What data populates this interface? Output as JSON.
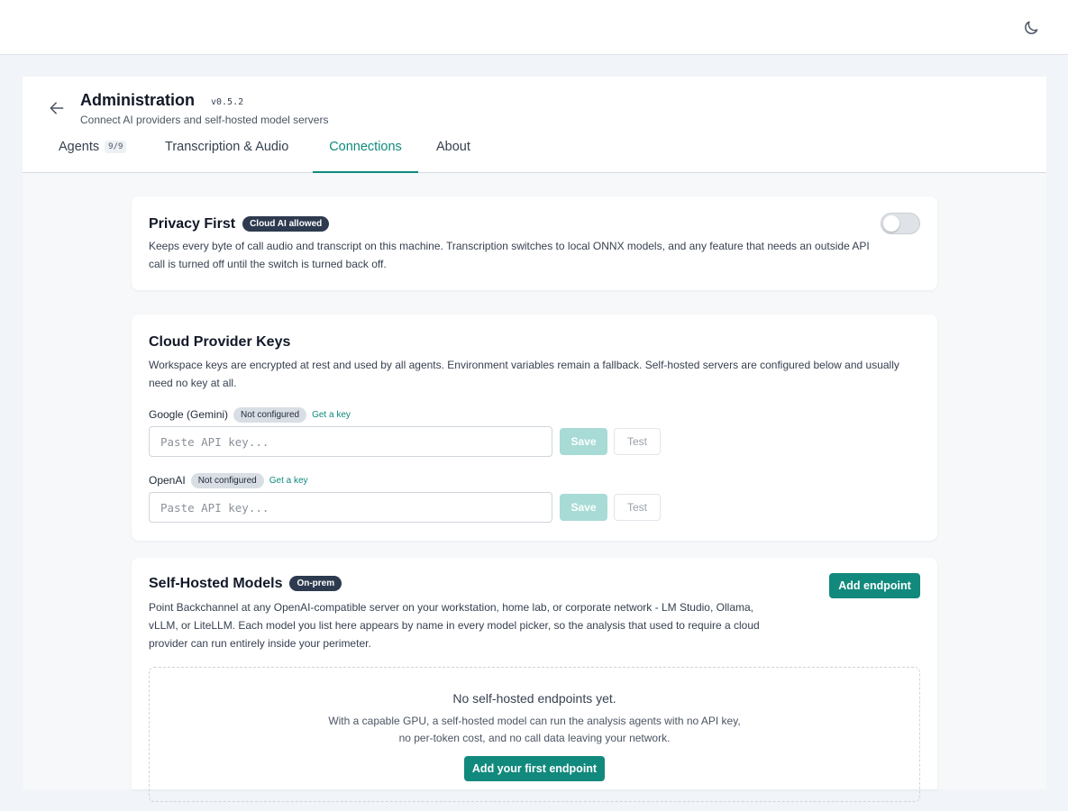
{
  "header": {
    "theme_icon": "moon-icon"
  },
  "page": {
    "title": "Administration",
    "version": "v0.5.2",
    "subtitle": "Connect AI providers and self-hosted model servers",
    "back_icon": "arrow-left-icon"
  },
  "tabs": [
    {
      "label": "Agents",
      "count": "9/9",
      "active": false
    },
    {
      "label": "Transcription & Audio",
      "active": false
    },
    {
      "label": "Connections",
      "active": true
    },
    {
      "label": "About",
      "active": false
    }
  ],
  "privacy": {
    "title": "Privacy First",
    "badge": "Cloud AI allowed",
    "description": "Keeps every byte of call audio and transcript on this machine. Transcription switches to local ONNX models, and any feature that needs an outside API call is turned off until the switch is turned back off.",
    "toggle_on": false
  },
  "cloud_keys": {
    "title": "Cloud Provider Keys",
    "description": "Workspace keys are encrypted at rest and used by all agents. Environment variables remain a fallback. Self-hosted servers are configured below and usually need no key at all.",
    "providers": [
      {
        "name": "Google (Gemini)",
        "status": "Not configured",
        "get_key": "Get a key",
        "placeholder": "Paste API key...",
        "save": "Save",
        "test": "Test"
      },
      {
        "name": "OpenAI",
        "status": "Not configured",
        "get_key": "Get a key",
        "placeholder": "Paste API key...",
        "save": "Save",
        "test": "Test"
      }
    ]
  },
  "self_hosted": {
    "title": "Self-Hosted Models",
    "badge": "On-prem",
    "add_button": "Add endpoint",
    "description": "Point Backchannel at any OpenAI-compatible server on your workstation, home lab, or corporate network - LM Studio, Ollama, vLLM, or LiteLLM. Each model you list here appears by name in every model picker, so the analysis that used to require a cloud provider can run entirely inside your perimeter.",
    "empty_title": "No self-hosted endpoints yet.",
    "empty_description": "With a capable GPU, a self-hosted model can run the analysis agents with no API key, no per-token cost, and no call data leaving your network.",
    "first_button": "Add your first endpoint"
  },
  "colors": {
    "accent": "#12897d",
    "accent_disabled": "#a8dbd5",
    "badge_dark": "#2d3a4f",
    "page_bg": "#f1f4f8"
  }
}
